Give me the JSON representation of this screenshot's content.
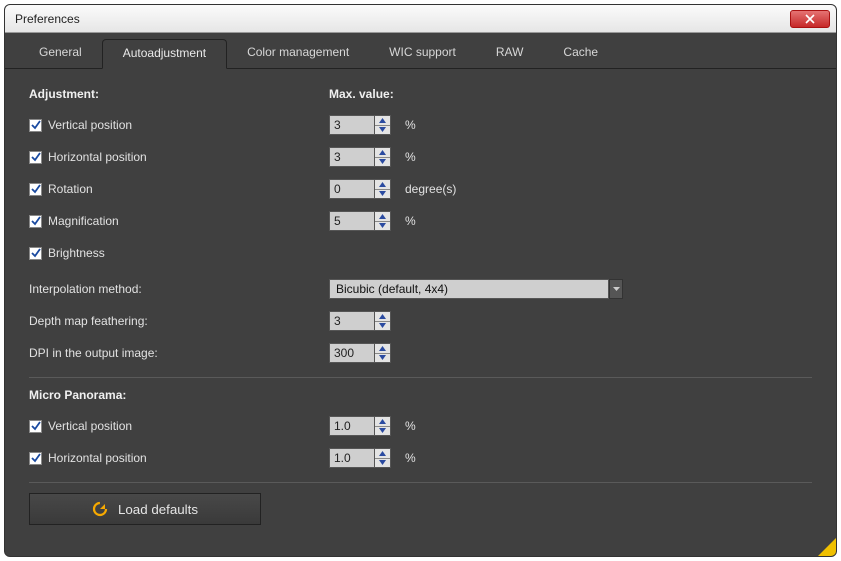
{
  "window": {
    "title": "Preferences"
  },
  "tabs": {
    "general": "General",
    "autoadjustment": "Autoadjustment",
    "color": "Color management",
    "wic": "WIC support",
    "raw": "RAW",
    "cache": "Cache"
  },
  "headings": {
    "adjustment": "Adjustment:",
    "maxvalue": "Max. value:",
    "micro": "Micro Panorama:"
  },
  "adjustment": {
    "vpos": {
      "label": "Vertical position",
      "value": "3",
      "unit": "%"
    },
    "hpos": {
      "label": "Horizontal position",
      "value": "3",
      "unit": "%"
    },
    "rotation": {
      "label": "Rotation",
      "value": "0",
      "unit": "degree(s)"
    },
    "magnification": {
      "label": "Magnification",
      "value": "5",
      "unit": "%"
    },
    "brightness": {
      "label": "Brightness"
    }
  },
  "interp": {
    "label": "Interpolation method:",
    "value": "Bicubic (default, 4x4)"
  },
  "feather": {
    "label": "Depth map feathering:",
    "value": "3"
  },
  "dpi": {
    "label": "DPI in the output image:",
    "value": "300"
  },
  "micro": {
    "vpos": {
      "label": "Vertical position",
      "value": "1.0",
      "unit": "%"
    },
    "hpos": {
      "label": "Horizontal position",
      "value": "1.0",
      "unit": "%"
    }
  },
  "buttons": {
    "load_defaults": "Load defaults"
  }
}
